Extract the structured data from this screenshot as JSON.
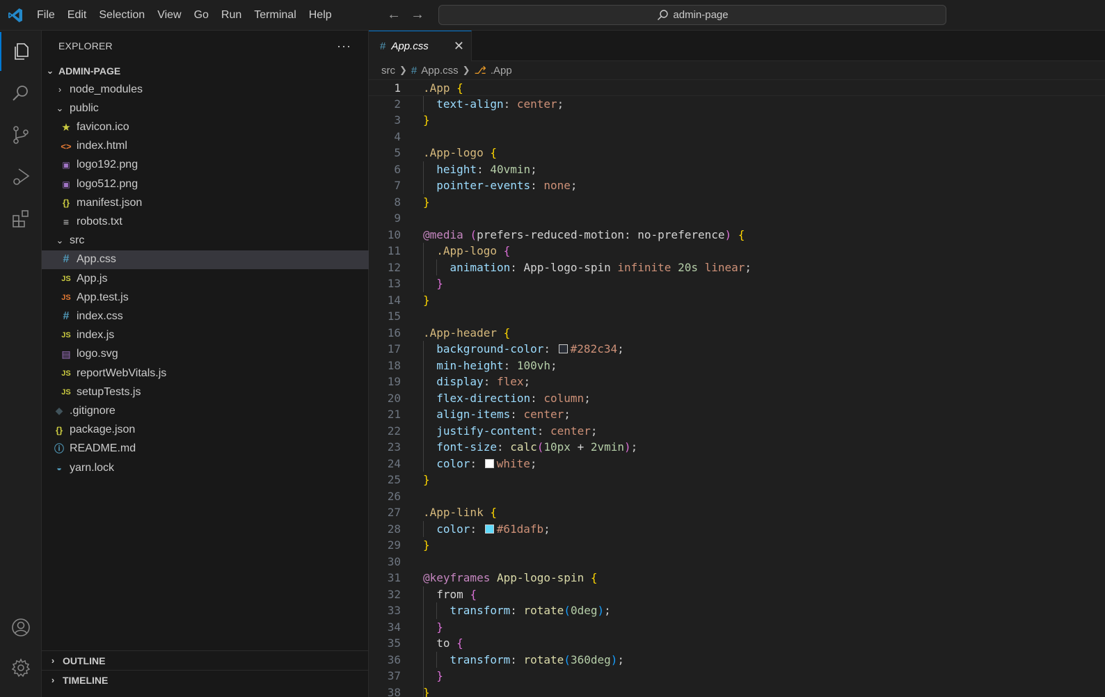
{
  "titlebar": {
    "menu": [
      "File",
      "Edit",
      "Selection",
      "View",
      "Go",
      "Run",
      "Terminal",
      "Help"
    ],
    "search_text": "admin-page"
  },
  "activity_bar": {
    "items": [
      "explorer-icon",
      "search-icon",
      "source-control-icon",
      "run-debug-icon",
      "extensions-icon"
    ],
    "bottom": [
      "account-icon",
      "settings-gear-icon"
    ]
  },
  "sidebar": {
    "title": "EXPLORER",
    "more": "···",
    "root": "ADMIN-PAGE",
    "tree": [
      {
        "label": "node_modules",
        "level": 1,
        "kind": "folder",
        "open": false
      },
      {
        "label": "public",
        "level": 1,
        "kind": "folder",
        "open": true
      },
      {
        "label": "favicon.ico",
        "level": 2,
        "kind": "star"
      },
      {
        "label": "index.html",
        "level": 2,
        "kind": "html"
      },
      {
        "label": "logo192.png",
        "level": 2,
        "kind": "img"
      },
      {
        "label": "logo512.png",
        "level": 2,
        "kind": "img"
      },
      {
        "label": "manifest.json",
        "level": 2,
        "kind": "json"
      },
      {
        "label": "robots.txt",
        "level": 2,
        "kind": "txt"
      },
      {
        "label": "src",
        "level": 1,
        "kind": "folder",
        "open": true
      },
      {
        "label": "App.css",
        "level": 2,
        "kind": "css",
        "selected": true
      },
      {
        "label": "App.js",
        "level": 2,
        "kind": "js"
      },
      {
        "label": "App.test.js",
        "level": 2,
        "kind": "jstest"
      },
      {
        "label": "index.css",
        "level": 2,
        "kind": "css"
      },
      {
        "label": "index.js",
        "level": 2,
        "kind": "js"
      },
      {
        "label": "logo.svg",
        "level": 2,
        "kind": "svg"
      },
      {
        "label": "reportWebVitals.js",
        "level": 2,
        "kind": "js"
      },
      {
        "label": "setupTests.js",
        "level": 2,
        "kind": "js"
      },
      {
        "label": ".gitignore",
        "level": 1,
        "kind": "git"
      },
      {
        "label": "package.json",
        "level": 1,
        "kind": "json"
      },
      {
        "label": "README.md",
        "level": 1,
        "kind": "info"
      },
      {
        "label": "yarn.lock",
        "level": 1,
        "kind": "yarn"
      }
    ],
    "sections": [
      "OUTLINE",
      "TIMELINE"
    ]
  },
  "editor": {
    "tab_label": "App.css",
    "breadcrumb": {
      "folder": "src",
      "file": "App.css",
      "symbol": ".App"
    },
    "current_line": 1,
    "lines": [
      [
        [
          "t-sel",
          ".App"
        ],
        [
          "t-plain",
          " "
        ],
        [
          "t-b1",
          "{"
        ]
      ],
      [
        [
          "t-plain",
          "  "
        ],
        [
          "t-prop",
          "text-align"
        ],
        [
          "t-punc",
          ": "
        ],
        [
          "t-val",
          "center"
        ],
        [
          "t-punc",
          ";"
        ]
      ],
      [
        [
          "t-b1",
          "}"
        ]
      ],
      [],
      [
        [
          "t-sel",
          ".App-logo"
        ],
        [
          "t-plain",
          " "
        ],
        [
          "t-b1",
          "{"
        ]
      ],
      [
        [
          "t-plain",
          "  "
        ],
        [
          "t-prop",
          "height"
        ],
        [
          "t-punc",
          ": "
        ],
        [
          "t-num",
          "40vmin"
        ],
        [
          "t-punc",
          ";"
        ]
      ],
      [
        [
          "t-plain",
          "  "
        ],
        [
          "t-prop",
          "pointer-events"
        ],
        [
          "t-punc",
          ": "
        ],
        [
          "t-val",
          "none"
        ],
        [
          "t-punc",
          ";"
        ]
      ],
      [
        [
          "t-b1",
          "}"
        ]
      ],
      [],
      [
        [
          "t-at",
          "@media"
        ],
        [
          "t-plain",
          " "
        ],
        [
          "t-b2",
          "("
        ],
        [
          "t-plain",
          "prefers-reduced-motion: no-preference"
        ],
        [
          "t-b2",
          ")"
        ],
        [
          "t-plain",
          " "
        ],
        [
          "t-b1",
          "{"
        ]
      ],
      [
        [
          "t-plain",
          "  "
        ],
        [
          "t-sel",
          ".App-logo"
        ],
        [
          "t-plain",
          " "
        ],
        [
          "t-b2",
          "{"
        ]
      ],
      [
        [
          "t-plain",
          "    "
        ],
        [
          "t-prop",
          "animation"
        ],
        [
          "t-punc",
          ": "
        ],
        [
          "t-plain",
          "App-logo-spin "
        ],
        [
          "t-val",
          "infinite"
        ],
        [
          "t-plain",
          " "
        ],
        [
          "t-num",
          "20s"
        ],
        [
          "t-plain",
          " "
        ],
        [
          "t-val",
          "linear"
        ],
        [
          "t-punc",
          ";"
        ]
      ],
      [
        [
          "t-plain",
          "  "
        ],
        [
          "t-b2",
          "}"
        ]
      ],
      [
        [
          "t-b1",
          "}"
        ]
      ],
      [],
      [
        [
          "t-sel",
          ".App-header"
        ],
        [
          "t-plain",
          " "
        ],
        [
          "t-b1",
          "{"
        ]
      ],
      [
        [
          "t-plain",
          "  "
        ],
        [
          "t-prop",
          "background-color"
        ],
        [
          "t-punc",
          ": "
        ],
        [
          "swatch",
          "#282c34"
        ],
        [
          "t-val",
          "#282c34"
        ],
        [
          "t-punc",
          ";"
        ]
      ],
      [
        [
          "t-plain",
          "  "
        ],
        [
          "t-prop",
          "min-height"
        ],
        [
          "t-punc",
          ": "
        ],
        [
          "t-num",
          "100vh"
        ],
        [
          "t-punc",
          ";"
        ]
      ],
      [
        [
          "t-plain",
          "  "
        ],
        [
          "t-prop",
          "display"
        ],
        [
          "t-punc",
          ": "
        ],
        [
          "t-val",
          "flex"
        ],
        [
          "t-punc",
          ";"
        ]
      ],
      [
        [
          "t-plain",
          "  "
        ],
        [
          "t-prop",
          "flex-direction"
        ],
        [
          "t-punc",
          ": "
        ],
        [
          "t-val",
          "column"
        ],
        [
          "t-punc",
          ";"
        ]
      ],
      [
        [
          "t-plain",
          "  "
        ],
        [
          "t-prop",
          "align-items"
        ],
        [
          "t-punc",
          ": "
        ],
        [
          "t-val",
          "center"
        ],
        [
          "t-punc",
          ";"
        ]
      ],
      [
        [
          "t-plain",
          "  "
        ],
        [
          "t-prop",
          "justify-content"
        ],
        [
          "t-punc",
          ": "
        ],
        [
          "t-val",
          "center"
        ],
        [
          "t-punc",
          ";"
        ]
      ],
      [
        [
          "t-plain",
          "  "
        ],
        [
          "t-prop",
          "font-size"
        ],
        [
          "t-punc",
          ": "
        ],
        [
          "t-fn",
          "calc"
        ],
        [
          "t-b2",
          "("
        ],
        [
          "t-num",
          "10px"
        ],
        [
          "t-plain",
          " + "
        ],
        [
          "t-num",
          "2vmin"
        ],
        [
          "t-b2",
          ")"
        ],
        [
          "t-punc",
          ";"
        ]
      ],
      [
        [
          "t-plain",
          "  "
        ],
        [
          "t-prop",
          "color"
        ],
        [
          "t-punc",
          ": "
        ],
        [
          "swatch",
          "#ffffff"
        ],
        [
          "t-val",
          "white"
        ],
        [
          "t-punc",
          ";"
        ]
      ],
      [
        [
          "t-b1",
          "}"
        ]
      ],
      [],
      [
        [
          "t-sel",
          ".App-link"
        ],
        [
          "t-plain",
          " "
        ],
        [
          "t-b1",
          "{"
        ]
      ],
      [
        [
          "t-plain",
          "  "
        ],
        [
          "t-prop",
          "color"
        ],
        [
          "t-punc",
          ": "
        ],
        [
          "swatch",
          "#61dafb"
        ],
        [
          "t-val",
          "#61dafb"
        ],
        [
          "t-punc",
          ";"
        ]
      ],
      [
        [
          "t-b1",
          "}"
        ]
      ],
      [],
      [
        [
          "t-at",
          "@keyframes"
        ],
        [
          "t-plain",
          " "
        ],
        [
          "t-fn",
          "App-logo-spin"
        ],
        [
          "t-plain",
          " "
        ],
        [
          "t-b1",
          "{"
        ]
      ],
      [
        [
          "t-plain",
          "  "
        ],
        [
          "t-plain",
          "from "
        ],
        [
          "t-b2",
          "{"
        ]
      ],
      [
        [
          "t-plain",
          "    "
        ],
        [
          "t-prop",
          "transform"
        ],
        [
          "t-punc",
          ": "
        ],
        [
          "t-fn",
          "rotate"
        ],
        [
          "t-b3",
          "("
        ],
        [
          "t-num",
          "0deg"
        ],
        [
          "t-b3",
          ")"
        ],
        [
          "t-punc",
          ";"
        ]
      ],
      [
        [
          "t-plain",
          "  "
        ],
        [
          "t-b2",
          "}"
        ]
      ],
      [
        [
          "t-plain",
          "  "
        ],
        [
          "t-plain",
          "to "
        ],
        [
          "t-b2",
          "{"
        ]
      ],
      [
        [
          "t-plain",
          "    "
        ],
        [
          "t-prop",
          "transform"
        ],
        [
          "t-punc",
          ": "
        ],
        [
          "t-fn",
          "rotate"
        ],
        [
          "t-b3",
          "("
        ],
        [
          "t-num",
          "360deg"
        ],
        [
          "t-b3",
          ")"
        ],
        [
          "t-punc",
          ";"
        ]
      ],
      [
        [
          "t-plain",
          "  "
        ],
        [
          "t-b2",
          "}"
        ]
      ],
      [
        [
          "t-b1",
          "}"
        ]
      ]
    ]
  },
  "colors": {
    "accent": "#0078d4",
    "background": "#1f1f1f",
    "sidebar": "#181818",
    "selection": "#37373d"
  }
}
